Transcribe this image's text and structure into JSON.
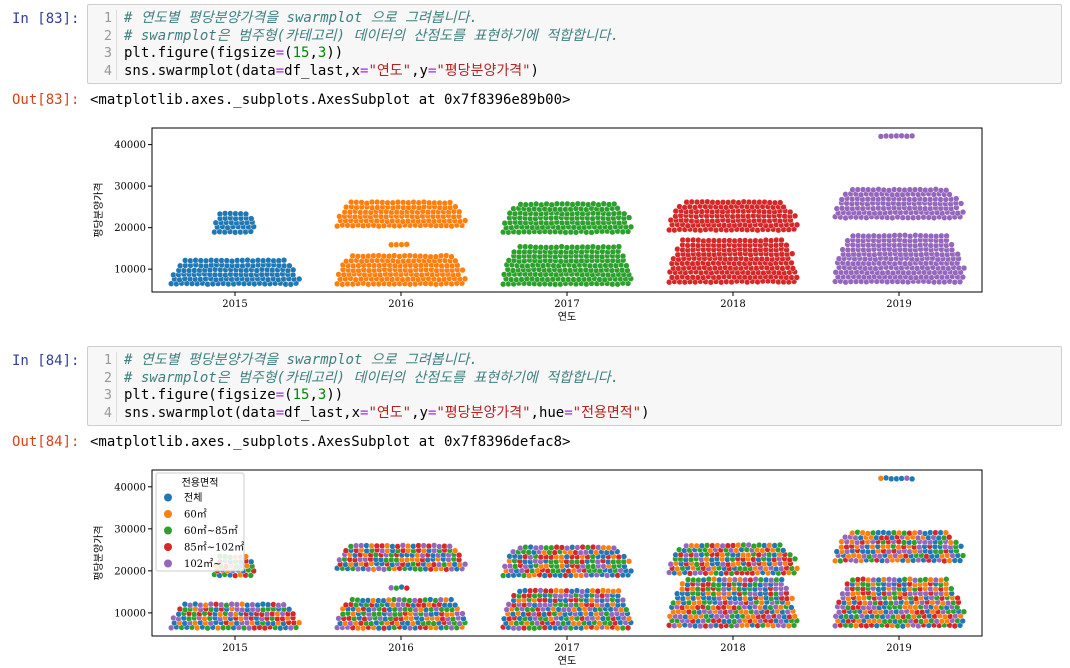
{
  "cells": [
    {
      "in_prompt": "In [83]:",
      "out_prompt": "Out[83]:",
      "line_numbers": [
        "1",
        "2",
        "3",
        "4"
      ],
      "comment1": "# 연도별 평당분양가격을 swarmplot 으로 그려봅니다.",
      "comment2": "# swarmplot은 범주형(카테고리) 데이터의 산점도를 표현하기에 적합합니다.",
      "l3_a": "plt.figure(figsize",
      "l3_b": "=",
      "l3_c": "(",
      "l3_d": "15",
      "l3_e": ",",
      "l3_f": "3",
      "l3_g": "))",
      "l4_a": "sns.swarmplot(data",
      "l4_b": "=",
      "l4_c": "df_last,x",
      "l4_d": "=",
      "l4_e": "\"연도\"",
      "l4_f": ",y",
      "l4_g": "=",
      "l4_h": "\"평당분양가격\"",
      "l4_i": ")",
      "output": "<matplotlib.axes._subplots.AxesSubplot at 0x7f8396e89b00>"
    },
    {
      "in_prompt": "In [84]:",
      "out_prompt": "Out[84]:",
      "line_numbers": [
        "1",
        "2",
        "3",
        "4"
      ],
      "comment1": "# 연도별 평당분양가격을 swarmplot 으로 그려봅니다.",
      "comment2": "# swarmplot은 범주형(카테고리) 데이터의 산점도를 표현하기에 적합합니다.",
      "l3_a": "plt.figure(figsize",
      "l3_b": "=",
      "l3_c": "(",
      "l3_d": "15",
      "l3_e": ",",
      "l3_f": "3",
      "l3_g": "))",
      "l4_a": "sns.swarmplot(data",
      "l4_b": "=",
      "l4_c": "df_last,x",
      "l4_d": "=",
      "l4_e": "\"연도\"",
      "l4_f": ",y",
      "l4_g": "=",
      "l4_h": "\"평당분양가격\"",
      "l4_i": ",hue",
      "l4_j": "=",
      "l4_k": "\"전용면적\"",
      "l4_l": ")",
      "output": "<matplotlib.axes._subplots.AxesSubplot at 0x7f8396defac8>"
    }
  ],
  "colors": {
    "blue": "#1f77b4",
    "orange": "#ff7f0e",
    "green": "#2ca02c",
    "red": "#d62728",
    "purple": "#9467bd"
  },
  "chart_data": [
    {
      "type": "scatter",
      "subtype": "swarm",
      "xlabel": "연도",
      "ylabel": "평당분양가격",
      "categories": [
        "2015",
        "2016",
        "2017",
        "2018",
        "2019"
      ],
      "ylim": [
        4500,
        44000
      ],
      "yticks": [
        10000,
        20000,
        30000,
        40000
      ],
      "ytick_labels": [
        "10000",
        "20000",
        "30000",
        "40000"
      ],
      "category_colors": [
        "#1f77b4",
        "#ff7f0e",
        "#2ca02c",
        "#d62728",
        "#9467bd"
      ],
      "bands": [
        [
          [
            6500,
            12500,
            0.8
          ],
          [
            19000,
            23500,
            0.28
          ]
        ],
        [
          [
            6500,
            14000,
            0.8
          ],
          [
            16000,
            17000,
            0.15
          ],
          [
            20500,
            26500,
            0.8
          ]
        ],
        [
          [
            6500,
            16000,
            0.8
          ],
          [
            19000,
            26000,
            0.8
          ]
        ],
        [
          [
            7000,
            18000,
            0.8
          ],
          [
            19500,
            26500,
            0.8
          ]
        ],
        [
          [
            7000,
            18500,
            0.8
          ],
          [
            22500,
            29500,
            0.8
          ],
          [
            42000,
            42000,
            0.25
          ]
        ]
      ]
    },
    {
      "type": "scatter",
      "subtype": "swarm",
      "xlabel": "연도",
      "ylabel": "평당분양가격",
      "categories": [
        "2015",
        "2016",
        "2017",
        "2018",
        "2019"
      ],
      "ylim": [
        4500,
        44000
      ],
      "yticks": [
        10000,
        20000,
        30000,
        40000
      ],
      "ytick_labels": [
        "10000",
        "20000",
        "30000",
        "40000"
      ],
      "legend_title": "전용면적",
      "legend_placement": "top-left",
      "series": [
        {
          "name": "전체",
          "color": "#1f77b4"
        },
        {
          "name": "60㎡",
          "color": "#ff7f0e"
        },
        {
          "name": "60㎡~85㎡",
          "color": "#2ca02c"
        },
        {
          "name": "85㎡~102㎡",
          "color": "#d62728"
        },
        {
          "name": "102㎡~",
          "color": "#9467bd"
        }
      ],
      "bands": [
        [
          [
            6500,
            12500,
            0.8
          ],
          [
            19000,
            23500,
            0.28
          ]
        ],
        [
          [
            6500,
            14000,
            0.8
          ],
          [
            16000,
            17000,
            0.15
          ],
          [
            20500,
            26500,
            0.8
          ]
        ],
        [
          [
            6500,
            16000,
            0.8
          ],
          [
            19000,
            26000,
            0.8
          ]
        ],
        [
          [
            7000,
            18000,
            0.8
          ],
          [
            19500,
            26500,
            0.8
          ]
        ],
        [
          [
            7000,
            18500,
            0.8
          ],
          [
            22500,
            29500,
            0.8
          ],
          [
            42000,
            42000,
            0.25
          ]
        ]
      ]
    }
  ]
}
